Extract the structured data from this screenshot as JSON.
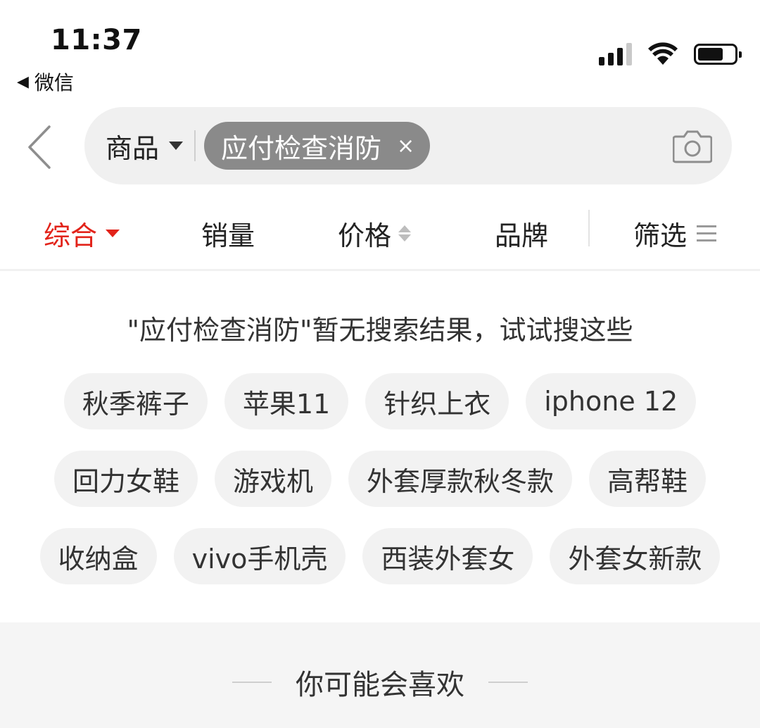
{
  "status_bar": {
    "time": "11:37",
    "back_app_label": "微信",
    "icons": [
      "signal-icon",
      "wifi-icon",
      "battery-icon"
    ]
  },
  "search": {
    "scope_label": "商品",
    "query": "应付检查消防",
    "clear_symbol": "×",
    "camera_icon": "camera-icon"
  },
  "tabs": [
    {
      "label": "综合",
      "active": true
    },
    {
      "label": "销量"
    },
    {
      "label": "价格"
    },
    {
      "label": "品牌"
    },
    {
      "label": "筛选"
    }
  ],
  "no_result_text": "\"应付检查消防\"暂无搜索结果，试试搜这些",
  "suggestions": [
    [
      "秋季裤子",
      "苹果11",
      "针织上衣",
      "iphone 12"
    ],
    [
      "回力女鞋",
      "游戏机",
      "外套厚款秋冬款",
      "高帮鞋"
    ],
    [
      "收纳盒",
      "vivo手机壳",
      "西装外套女",
      "外套女新款"
    ]
  ],
  "recommend_title": "你可能会喜欢",
  "colors": {
    "accent": "#e2231a",
    "chip_bg": "#f2f2f2",
    "query_chip_bg": "#8a8a8a"
  }
}
